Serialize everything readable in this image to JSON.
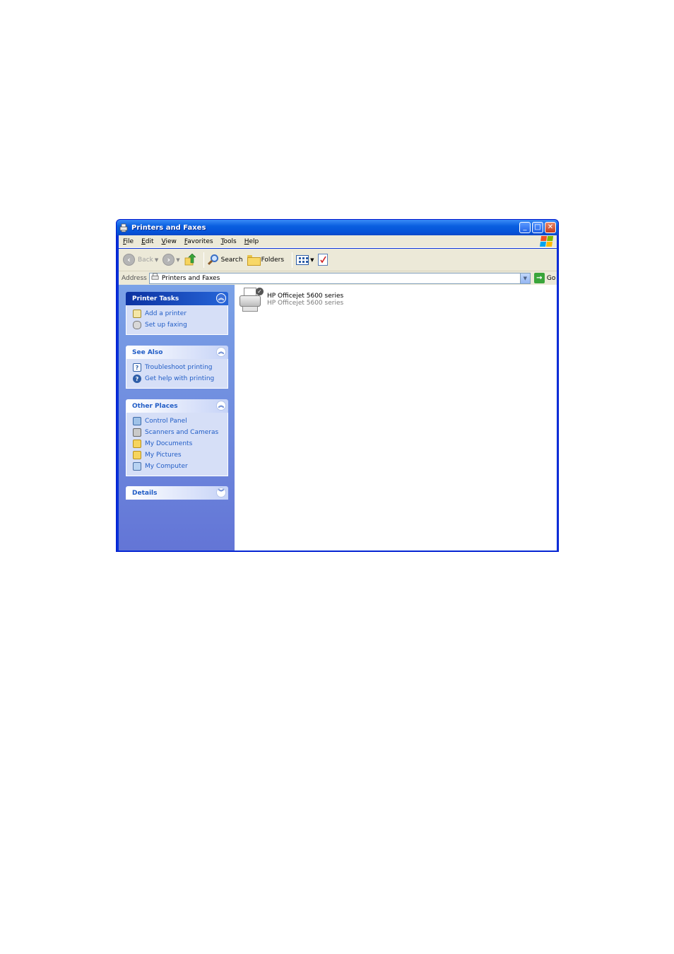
{
  "window": {
    "title": "Printers and Faxes",
    "buttons": {
      "minimize": "_",
      "maximize": "□",
      "close": "✕"
    }
  },
  "menubar": {
    "items": [
      "File",
      "Edit",
      "View",
      "Favorites",
      "Tools",
      "Help"
    ]
  },
  "toolbar": {
    "back_label": "Back",
    "search_label": "Search",
    "folders_label": "Folders"
  },
  "address": {
    "label": "Address",
    "value": "Printers and Faxes",
    "go_label": "Go"
  },
  "taskpane": {
    "printer_tasks": {
      "title": "Printer Tasks",
      "items": [
        {
          "label": "Add a printer",
          "icon": "add-printer-icon"
        },
        {
          "label": "Set up faxing",
          "icon": "fax-icon"
        }
      ]
    },
    "see_also": {
      "title": "See Also",
      "items": [
        {
          "label": "Troubleshoot printing",
          "icon": "help-book-icon"
        },
        {
          "label": "Get help with printing",
          "icon": "help-icon"
        }
      ]
    },
    "other_places": {
      "title": "Other Places",
      "items": [
        {
          "label": "Control Panel",
          "icon": "control-panel-icon"
        },
        {
          "label": "Scanners and Cameras",
          "icon": "scanner-icon"
        },
        {
          "label": "My Documents",
          "icon": "documents-icon"
        },
        {
          "label": "My Pictures",
          "icon": "pictures-icon"
        },
        {
          "label": "My Computer",
          "icon": "computer-icon"
        }
      ]
    },
    "details": {
      "title": "Details"
    }
  },
  "content": {
    "printers": [
      {
        "name": "HP Officejet 5600 series",
        "description": "HP Officejet 5600 series",
        "is_default": true
      }
    ]
  },
  "colors": {
    "titlebar": "#0553d8",
    "taskpane_top": "#7ba2e7",
    "taskpane_bottom": "#6375d6",
    "link": "#215dc6"
  }
}
